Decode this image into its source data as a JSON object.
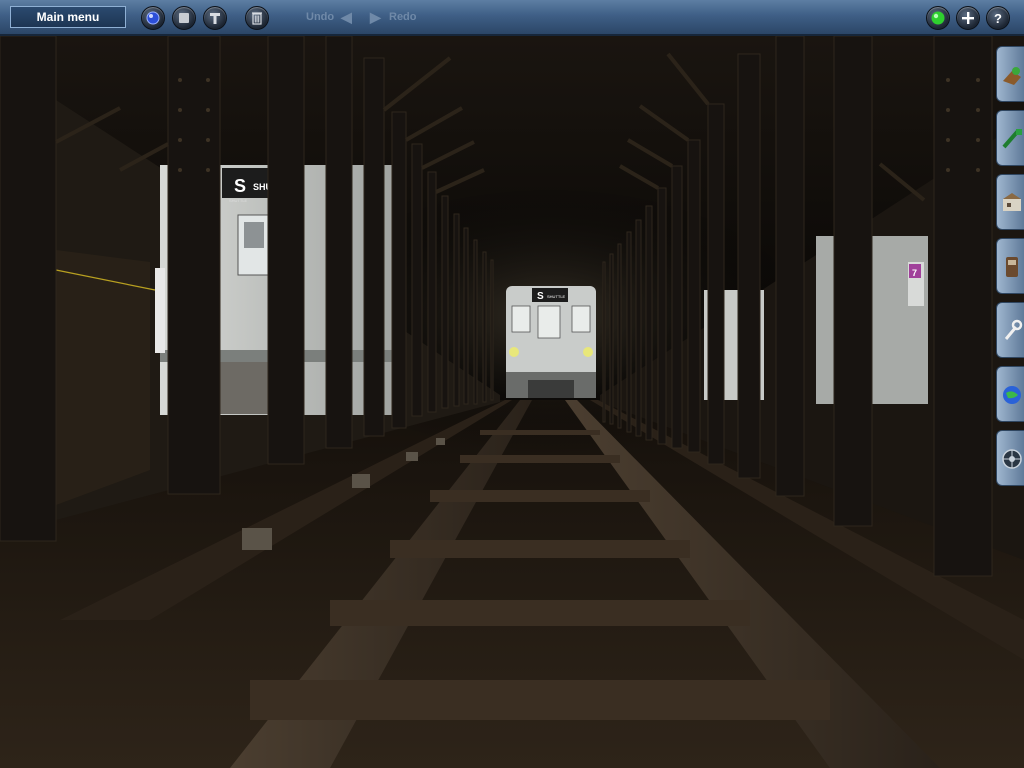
{
  "toolbar": {
    "main_menu_label": "Main menu",
    "undo_label": "Undo",
    "redo_label": "Redo",
    "buttons": {
      "driver": "driver-icon",
      "stop": "stop-icon",
      "tools": "wrench-icon",
      "delete": "trash-icon",
      "status": "green-light-icon",
      "add": "plus-icon",
      "help": "question-icon"
    }
  },
  "side_panel": {
    "tabs": [
      {
        "name": "tab-trainz-assets",
        "icon": "asset-icon"
      },
      {
        "name": "tab-track-laying",
        "icon": "track-icon"
      },
      {
        "name": "tab-buildings",
        "icon": "building-icon"
      },
      {
        "name": "tab-trains",
        "icon": "train-icon"
      },
      {
        "name": "tab-tools",
        "icon": "wrench-icon"
      },
      {
        "name": "tab-environment",
        "icon": "globe-icon"
      },
      {
        "name": "tab-options",
        "icon": "wheel-icon"
      }
    ]
  },
  "scene": {
    "near_train_sign": {
      "route": "S",
      "destination": "SHU",
      "service": "SHUTTLE"
    },
    "far_train_sign": {
      "route": "S",
      "destination": "SHUTTLE"
    },
    "right_train_sign": {
      "route": "7"
    }
  },
  "colors": {
    "toolbar": "#3f5f86",
    "menu_border": "#8fb0d4",
    "tab": "#9fb6cf"
  }
}
